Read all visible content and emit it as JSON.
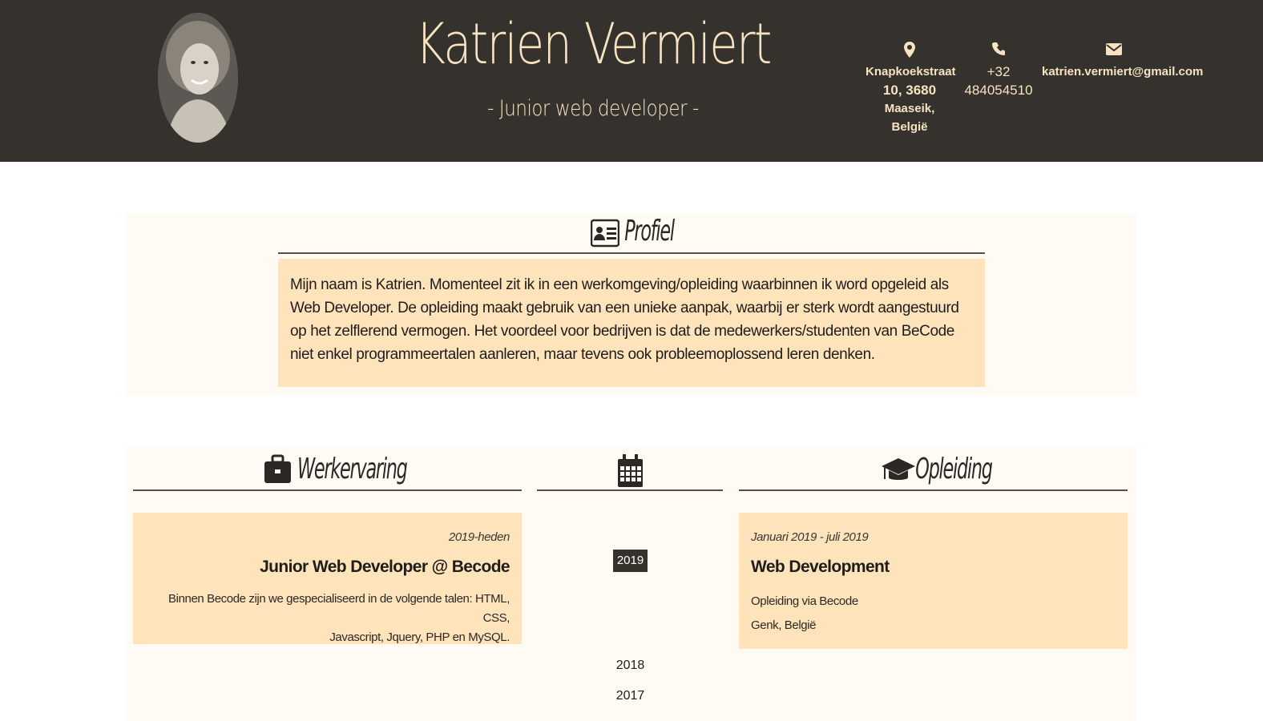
{
  "header": {
    "name": "Katrien Vermiert",
    "subtitle": "- Junior web developer -",
    "avatar_icon": "profile-photo",
    "address": {
      "icon": "map-marker-icon",
      "line1": "Knapkoekstraat",
      "line2": "10, 3680",
      "line3": "Maaseik, België"
    },
    "phone": {
      "icon": "phone-icon",
      "line1": "+32",
      "line2": "484054510"
    },
    "email": {
      "icon": "envelope-icon",
      "value": "katrien.vermiert@gmail.com"
    }
  },
  "profiel": {
    "icon": "id-card-icon",
    "title": "Profiel",
    "text": "Mijn naam is Katrien. Momenteel zit ik in een werkomgeving/opleiding waarbinnen ik word opgeleid als Web Developer. De opleiding maakt gebruik van een unieke aanpak, waarbij er sterk wordt aangestuurd op het zelflerend vermogen. Het voordeel voor bedrijven is dat de medewerkers/studenten van BeCode niet enkel programmeertalen aanleren, maar tevens ook probleemoplossend leren denken."
  },
  "werkervaring": {
    "icon": "briefcase-icon",
    "title": "Werkervaring",
    "items": [
      {
        "date": "2019-heden",
        "role": "Junior Web Developer @ Becode",
        "desc_line1": "Binnen Becode zijn we gespecialiseerd in de volgende talen: HTML, CSS,",
        "desc_line2": "Javascript, Jquery, PHP en MySQL."
      }
    ]
  },
  "timeline": {
    "icon": "calendar-icon",
    "active_year": "2019",
    "years": [
      "2018",
      "2017"
    ]
  },
  "opleiding": {
    "icon": "graduation-cap-icon",
    "title": "Opleiding",
    "items": [
      {
        "date": "Januari 2019 - juli 2019",
        "role": "Web Development",
        "line1": "Opleiding via Becode",
        "line2": "Genk, België"
      }
    ]
  },
  "colors": {
    "header_bg": "#35322e",
    "header_text": "#f7e2c2",
    "card_bg": "#fee3bb",
    "panel_bg": "#fffaf3"
  }
}
